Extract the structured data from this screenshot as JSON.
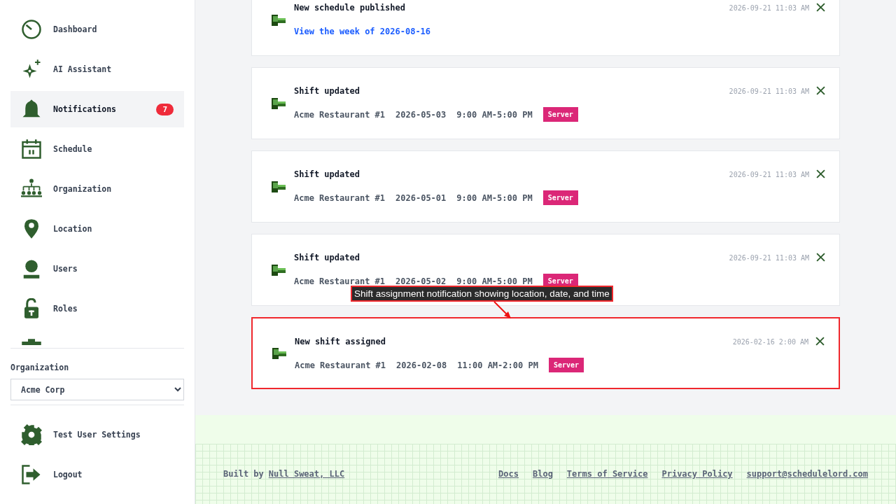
{
  "sidebar": {
    "nav_items": [
      {
        "label": "Dashboard",
        "selected": false
      },
      {
        "label": "AI Assistant",
        "selected": false
      },
      {
        "label": "Notifications",
        "selected": true,
        "badge": "7"
      },
      {
        "label": "Schedule",
        "selected": false
      },
      {
        "label": "Organization",
        "selected": false
      },
      {
        "label": "Location",
        "selected": false
      },
      {
        "label": "Users",
        "selected": false
      },
      {
        "label": "Roles",
        "selected": false
      },
      {
        "selected": false
      }
    ],
    "organization": {
      "label": "Organization",
      "value": "Acme Corp"
    },
    "bottom_items": [
      {
        "label": "Test User Settings"
      },
      {
        "label": "Logout"
      }
    ]
  },
  "notifications": [
    {
      "kind": "link",
      "title": "New schedule published",
      "timestamp": "2026-09-21 11:03 AM",
      "link": "View the week of 2026-08-16",
      "annotated": false
    },
    {
      "kind": "shift",
      "title": "Shift updated",
      "timestamp": "2026-09-21 11:03 AM",
      "location": "Acme Restaurant #1",
      "date": "2026-05-03",
      "time": "9:00 AM-5:00 PM",
      "role": "Server",
      "annotated": false
    },
    {
      "kind": "shift",
      "title": "Shift updated",
      "timestamp": "2026-09-21 11:03 AM",
      "location": "Acme Restaurant #1",
      "date": "2026-05-01",
      "time": "9:00 AM-5:00 PM",
      "role": "Server",
      "annotated": false
    },
    {
      "kind": "shift",
      "title": "Shift updated",
      "timestamp": "2026-09-21 11:03 AM",
      "location": "Acme Restaurant #1",
      "date": "2026-05-02",
      "time": "9:00 AM-5:00 PM",
      "role": "Server",
      "annotated": false
    },
    {
      "kind": "shift",
      "title": "New shift assigned",
      "timestamp": "2026-02-16 2:00 AM",
      "location": "Acme Restaurant #1",
      "date": "2026-02-08",
      "time": "11:00 AM-2:00 PM",
      "role": "Server",
      "annotated": true
    }
  ],
  "annotation": {
    "text": "Shift assignment notification showing location, date, and time"
  },
  "footer": {
    "built_by": "Built by",
    "company_link": "Null Sweat, LLC",
    "links": [
      "Docs",
      "Blog",
      "Terms of Service",
      "Privacy Policy",
      "support@schedulelord.com"
    ]
  }
}
